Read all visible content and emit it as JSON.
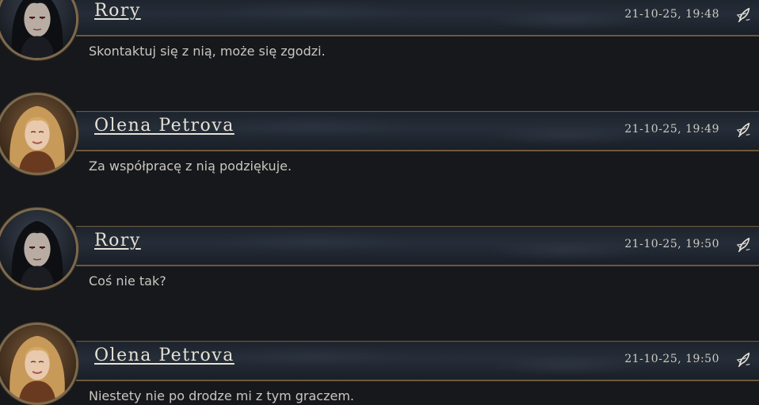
{
  "thread": {
    "posts": [
      {
        "author": "Rory",
        "avatar_alt": "dark-haired-man-portrait",
        "timestamp": "21-10-25, 19:48",
        "message": "Skontaktuj się z nią, może się zgodzi.",
        "action_icon": "quill-icon"
      },
      {
        "author": "Olena Petrova",
        "avatar_alt": "blonde-woman-portrait",
        "timestamp": "21-10-25, 19:49",
        "message": "Za współpracę z nią podziękuje.",
        "action_icon": "quill-icon"
      },
      {
        "author": "Rory",
        "avatar_alt": "dark-haired-man-portrait",
        "timestamp": "21-10-25, 19:50",
        "message": "Coś nie tak?",
        "action_icon": "quill-icon"
      },
      {
        "author": "Olena Petrova",
        "avatar_alt": "blonde-woman-portrait",
        "timestamp": "21-10-25, 19:50",
        "message": "Niestety nie po drodze mi z tym graczem.",
        "action_icon": "quill-icon"
      }
    ]
  },
  "colors": {
    "background": "#17181c",
    "bar_border": "#6d583a",
    "name_text": "#e6e1d6",
    "message_text": "#c9c6c0",
    "avatar_ring": "#7c6a4d"
  }
}
